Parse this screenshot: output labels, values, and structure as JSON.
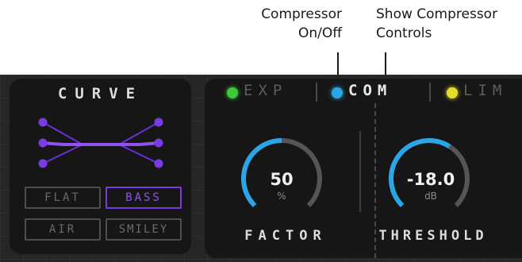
{
  "callouts": {
    "compressor_onoff": [
      "Compressor",
      "On/Off"
    ],
    "show_controls": [
      "Show Compressor",
      "Controls"
    ]
  },
  "curve": {
    "title": "CURVE",
    "presets": [
      {
        "label": "FLAT",
        "active": false
      },
      {
        "label": "BASS",
        "active": true
      },
      {
        "label": "AIR",
        "active": false
      },
      {
        "label": "SMILEY",
        "active": false
      }
    ],
    "accent_color": "#7a3ae6"
  },
  "dynamics": {
    "tabs": [
      {
        "label": "EXP",
        "dot_color": "#3fc83c",
        "selected": false
      },
      {
        "label": "COM",
        "dot_color": "#2aa6e6",
        "selected": true
      },
      {
        "label": "LIM",
        "dot_color": "#e6dc2a",
        "selected": false
      }
    ],
    "factor": {
      "value": "50",
      "unit": "%",
      "label": "FACTOR",
      "level": 0.5
    },
    "threshold": {
      "value": "-18.0",
      "unit": "dB",
      "label": "THRESHOLD",
      "level": 0.62
    },
    "knob_color": "#2aa6e6",
    "knob_track_color": "#555555"
  }
}
